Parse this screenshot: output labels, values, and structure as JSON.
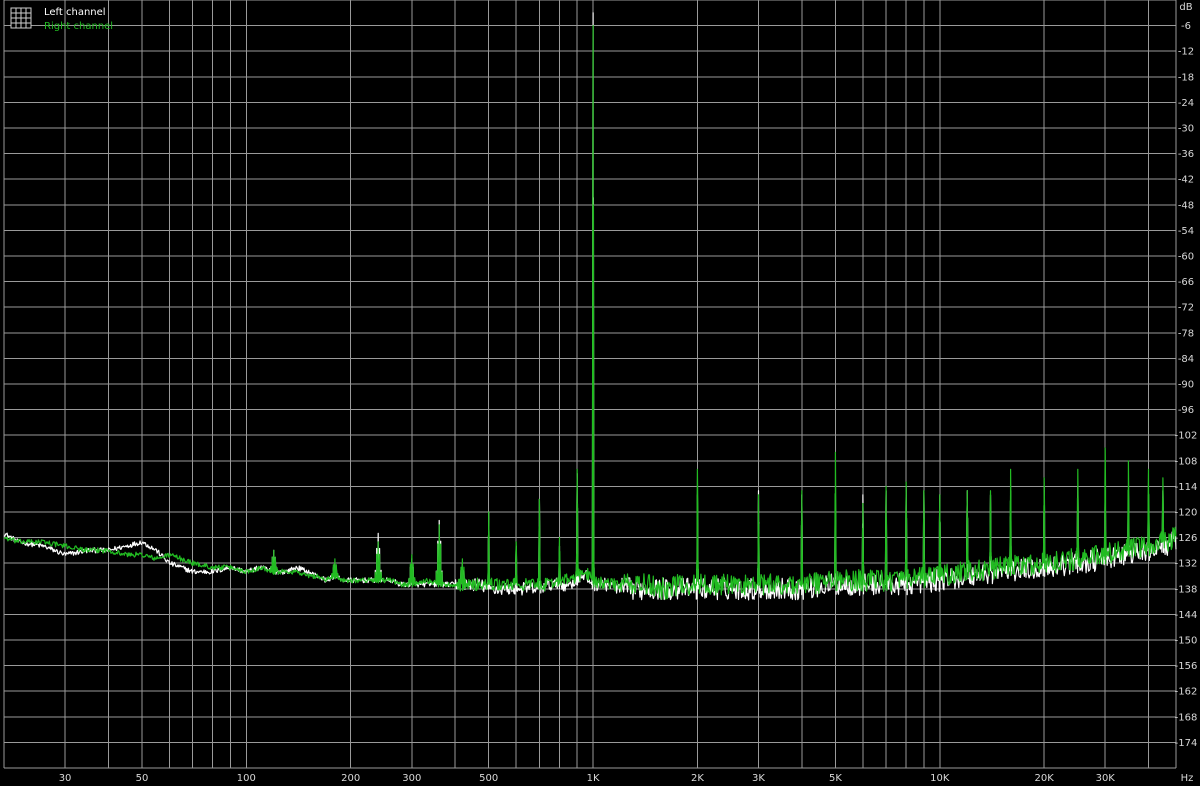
{
  "chart_data": {
    "type": "line",
    "title": "",
    "xlabel": "",
    "ylabel": "",
    "x_unit": "Hz",
    "y_unit": "dB",
    "x_scale": "log",
    "xlim": [
      20,
      48000
    ],
    "ylim": [
      -180,
      0
    ],
    "grid": true,
    "legend_position": "top-left",
    "x_ticks": [
      {
        "value": 30,
        "label": "30"
      },
      {
        "value": 50,
        "label": "50"
      },
      {
        "value": 100,
        "label": "100"
      },
      {
        "value": 200,
        "label": "200"
      },
      {
        "value": 300,
        "label": "300"
      },
      {
        "value": 500,
        "label": "500"
      },
      {
        "value": 1000,
        "label": "1K"
      },
      {
        "value": 2000,
        "label": "2K"
      },
      {
        "value": 3000,
        "label": "3K"
      },
      {
        "value": 5000,
        "label": "5K"
      },
      {
        "value": 10000,
        "label": "10K"
      },
      {
        "value": 20000,
        "label": "20K"
      },
      {
        "value": 30000,
        "label": "30K"
      }
    ],
    "y_ticks": [
      -6,
      -12,
      -18,
      -24,
      -30,
      -36,
      -42,
      -48,
      -54,
      -60,
      -66,
      -72,
      -78,
      -84,
      -90,
      -96,
      -102,
      -108,
      -114,
      -120,
      -126,
      -132,
      -138,
      -144,
      -150,
      -156,
      -162,
      -168,
      -174
    ],
    "series": [
      {
        "name": "Left channel",
        "color": "#ffffff",
        "points": [
          [
            20,
            -125
          ],
          [
            22,
            -127
          ],
          [
            26,
            -128
          ],
          [
            30,
            -130
          ],
          [
            35,
            -129
          ],
          [
            40,
            -129
          ],
          [
            45,
            -128
          ],
          [
            50,
            -127
          ],
          [
            55,
            -129
          ],
          [
            60,
            -132
          ],
          [
            65,
            -133
          ],
          [
            70,
            -134
          ],
          [
            80,
            -134
          ],
          [
            90,
            -133
          ],
          [
            100,
            -134
          ],
          [
            110,
            -133
          ],
          [
            120,
            -134
          ],
          [
            130,
            -134
          ],
          [
            140,
            -133
          ],
          [
            150,
            -134
          ],
          [
            160,
            -135
          ],
          [
            170,
            -136
          ],
          [
            180,
            -135
          ],
          [
            190,
            -136
          ],
          [
            200,
            -136
          ],
          [
            220,
            -136
          ],
          [
            240,
            -136
          ],
          [
            260,
            -136
          ],
          [
            280,
            -137
          ],
          [
            300,
            -137
          ],
          [
            330,
            -137
          ],
          [
            360,
            -137
          ],
          [
            400,
            -137
          ],
          [
            430,
            -137
          ],
          [
            470,
            -137
          ],
          [
            500,
            -138
          ],
          [
            550,
            -138
          ],
          [
            600,
            -138
          ],
          [
            650,
            -138
          ],
          [
            700,
            -138
          ],
          [
            750,
            -137
          ],
          [
            800,
            -137
          ],
          [
            850,
            -137
          ],
          [
            900,
            -136
          ],
          [
            950,
            -135
          ],
          [
            1000,
            -137
          ],
          [
            1100,
            -137
          ],
          [
            1200,
            -138
          ],
          [
            1400,
            -138
          ],
          [
            1600,
            -138
          ],
          [
            1800,
            -138
          ],
          [
            2000,
            -138
          ],
          [
            2500,
            -138
          ],
          [
            3000,
            -138
          ],
          [
            4000,
            -138
          ],
          [
            5000,
            -137
          ],
          [
            6000,
            -137
          ],
          [
            7000,
            -137
          ],
          [
            8000,
            -137
          ],
          [
            10000,
            -136
          ],
          [
            12000,
            -135
          ],
          [
            15000,
            -134
          ],
          [
            20000,
            -133
          ],
          [
            25000,
            -132
          ],
          [
            30000,
            -131
          ],
          [
            35000,
            -130
          ],
          [
            40000,
            -129
          ],
          [
            44000,
            -128
          ],
          [
            48000,
            -127
          ]
        ],
        "peaks": [
          [
            120,
            -129
          ],
          [
            180,
            -132
          ],
          [
            240,
            -125
          ],
          [
            300,
            -131
          ],
          [
            360,
            -122
          ],
          [
            420,
            -132
          ],
          [
            500,
            -120
          ],
          [
            600,
            -128
          ],
          [
            700,
            -117
          ],
          [
            800,
            -128
          ],
          [
            900,
            -111
          ],
          [
            1000,
            -3
          ],
          [
            2000,
            -116
          ],
          [
            3000,
            -115
          ],
          [
            4000,
            -116
          ],
          [
            5000,
            -116
          ],
          [
            6000,
            -116
          ],
          [
            7000,
            -115
          ],
          [
            8000,
            -114
          ],
          [
            9000,
            -115
          ],
          [
            10000,
            -116
          ],
          [
            12000,
            -115
          ],
          [
            14000,
            -116
          ],
          [
            16000,
            -115
          ],
          [
            20000,
            -114
          ],
          [
            25000,
            -114
          ],
          [
            30000,
            -116
          ],
          [
            35000,
            -115
          ],
          [
            40000,
            -116
          ],
          [
            44000,
            -115
          ]
        ]
      },
      {
        "name": "Right channel",
        "color": "#22bb22",
        "points": [
          [
            20,
            -126
          ],
          [
            22,
            -127
          ],
          [
            26,
            -127
          ],
          [
            30,
            -128
          ],
          [
            35,
            -129
          ],
          [
            40,
            -129
          ],
          [
            45,
            -130
          ],
          [
            50,
            -130
          ],
          [
            55,
            -131
          ],
          [
            60,
            -130
          ],
          [
            65,
            -131
          ],
          [
            70,
            -132
          ],
          [
            80,
            -133
          ],
          [
            90,
            -133
          ],
          [
            100,
            -134
          ],
          [
            110,
            -133
          ],
          [
            120,
            -134
          ],
          [
            130,
            -134
          ],
          [
            140,
            -134
          ],
          [
            150,
            -135
          ],
          [
            160,
            -135
          ],
          [
            170,
            -136
          ],
          [
            180,
            -135
          ],
          [
            190,
            -136
          ],
          [
            200,
            -136
          ],
          [
            220,
            -136
          ],
          [
            240,
            -136
          ],
          [
            260,
            -136
          ],
          [
            280,
            -137
          ],
          [
            300,
            -137
          ],
          [
            330,
            -136
          ],
          [
            360,
            -137
          ],
          [
            400,
            -137
          ],
          [
            430,
            -137
          ],
          [
            470,
            -137
          ],
          [
            500,
            -137
          ],
          [
            550,
            -137
          ],
          [
            600,
            -137
          ],
          [
            650,
            -137
          ],
          [
            700,
            -137
          ],
          [
            750,
            -137
          ],
          [
            800,
            -136
          ],
          [
            850,
            -136
          ],
          [
            900,
            -135
          ],
          [
            950,
            -134
          ],
          [
            1000,
            -136
          ],
          [
            1100,
            -137
          ],
          [
            1200,
            -137
          ],
          [
            1400,
            -137
          ],
          [
            1600,
            -138
          ],
          [
            1800,
            -137
          ],
          [
            2000,
            -137
          ],
          [
            2500,
            -137
          ],
          [
            3000,
            -137
          ],
          [
            4000,
            -137
          ],
          [
            5000,
            -136
          ],
          [
            6000,
            -136
          ],
          [
            7000,
            -136
          ],
          [
            8000,
            -136
          ],
          [
            10000,
            -135
          ],
          [
            12000,
            -134
          ],
          [
            15000,
            -133
          ],
          [
            20000,
            -132
          ],
          [
            25000,
            -131
          ],
          [
            30000,
            -130
          ],
          [
            35000,
            -129
          ],
          [
            40000,
            -128
          ],
          [
            44000,
            -127
          ],
          [
            48000,
            -126
          ]
        ],
        "peaks": [
          [
            120,
            -129
          ],
          [
            180,
            -131
          ],
          [
            240,
            -127
          ],
          [
            300,
            -130
          ],
          [
            360,
            -123
          ],
          [
            420,
            -131
          ],
          [
            500,
            -120
          ],
          [
            600,
            -127
          ],
          [
            700,
            -117
          ],
          [
            800,
            -126
          ],
          [
            900,
            -110
          ],
          [
            1000,
            -6
          ],
          [
            2000,
            -110
          ],
          [
            3000,
            -116
          ],
          [
            4000,
            -115
          ],
          [
            5000,
            -106
          ],
          [
            6000,
            -118
          ],
          [
            7000,
            -114
          ],
          [
            8000,
            -113
          ],
          [
            9000,
            -115
          ],
          [
            10000,
            -116
          ],
          [
            12000,
            -115
          ],
          [
            14000,
            -115
          ],
          [
            16000,
            -110
          ],
          [
            20000,
            -112
          ],
          [
            25000,
            -110
          ],
          [
            30000,
            -105
          ],
          [
            35000,
            -108
          ],
          [
            40000,
            -110
          ],
          [
            44000,
            -112
          ]
        ]
      }
    ]
  }
}
